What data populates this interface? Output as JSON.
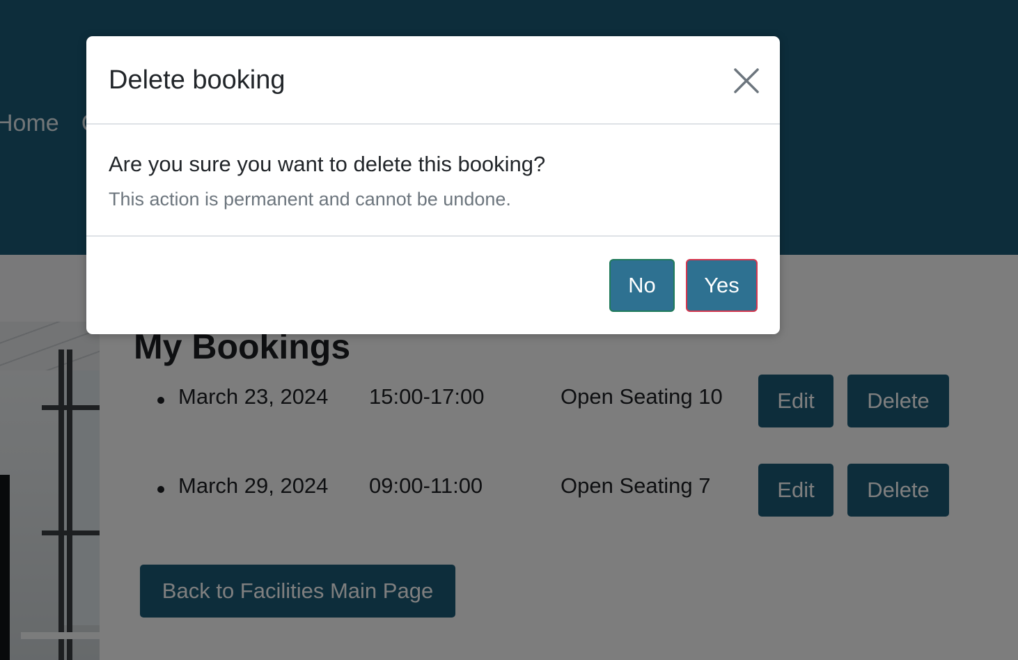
{
  "nav": {
    "items": [
      "Home",
      "C"
    ]
  },
  "page": {
    "title": "My Bookings",
    "back_label": "Back to Facilities Main Page"
  },
  "bookings": [
    {
      "date": "March 23, 2024",
      "time": "15:00-17:00",
      "room": "Open Seating 10",
      "edit_label": "Edit",
      "delete_label": "Delete"
    },
    {
      "date": "March 29, 2024",
      "time": "09:00-11:00",
      "room": "Open Seating 7",
      "edit_label": "Edit",
      "delete_label": "Delete"
    }
  ],
  "modal": {
    "title": "Delete booking",
    "question": "Are you sure you want to delete this booking?",
    "warning": "This action is permanent and cannot be undone.",
    "no_label": "No",
    "yes_label": "Yes",
    "close_icon": "close-icon"
  },
  "colors": {
    "header": "#1a5a77",
    "primary_button": "#1a5a77",
    "modal_button": "#2e7191",
    "no_border": "#1f7a5a",
    "yes_border": "#d4364e"
  }
}
